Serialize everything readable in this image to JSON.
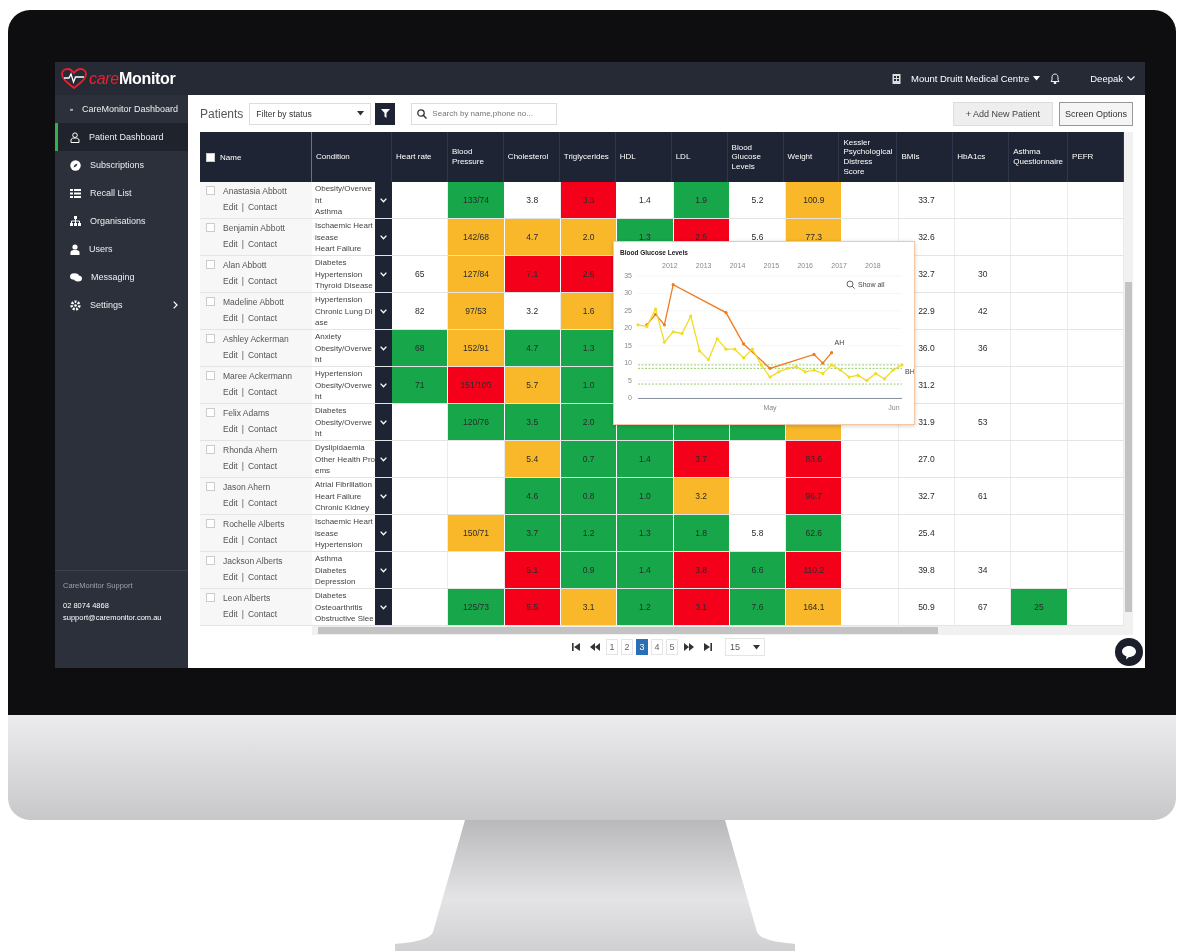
{
  "top_bar": {
    "logo": {
      "accent": "care",
      "text": "Monitor"
    },
    "clinic": "Mount Druitt Medical Centre",
    "user": "Deepak"
  },
  "sidebar": {
    "items": [
      {
        "label": "CareMonitor Dashboard",
        "selected": false,
        "has_submenu": false
      },
      {
        "label": "Patient Dashboard",
        "selected": true,
        "has_submenu": false
      },
      {
        "label": "Subscriptions",
        "selected": false,
        "has_submenu": false
      },
      {
        "label": "Recall List",
        "selected": false,
        "has_submenu": false
      },
      {
        "label": "Organisations",
        "selected": false,
        "has_submenu": false
      },
      {
        "label": "Users",
        "selected": false,
        "has_submenu": false
      },
      {
        "label": "Messaging",
        "selected": false,
        "has_submenu": false
      },
      {
        "label": "Settings",
        "selected": false,
        "has_submenu": true
      }
    ],
    "support": {
      "title": "CareMonitor Support",
      "phone": "02 8074 4868",
      "email": "support@caremonitor.com.au"
    }
  },
  "toolbar": {
    "title": "Patients",
    "filter": "Filter by status",
    "search_placeholder": "Search by name,phone no...",
    "add_button": "+ Add New Patient",
    "options_button": "Screen Options"
  },
  "table": {
    "select_all": {
      "checked": false
    },
    "name_header": "Name",
    "condition_header": "Condition",
    "columns": [
      "Heart rate",
      "Blood Pressure",
      "Cholesterol",
      "Triglycerides",
      "HDL",
      "LDL",
      "Blood Glucose Levels",
      "Weight",
      "Kessler Psychological Distress Score",
      "BMIs",
      "HbA1cs",
      "Asthma Questionnaire",
      "PEFR"
    ],
    "rows": [
      {
        "checked": false,
        "name": "Anastasia Abbott",
        "edit": "Edit",
        "separator": "|",
        "contact": "Contact",
        "conditions": [
          "Obesity/Overwe",
          "ht",
          "Asthma"
        ],
        "cells": [
          null,
          {
            "value": "133/74",
            "color": "#17a74a"
          },
          {
            "value": "3.8"
          },
          {
            "value": "3.3",
            "color": "#f4001b"
          },
          {
            "value": "1.4"
          },
          {
            "value": "1.9",
            "color": "#17a74a"
          },
          {
            "value": "5.2"
          },
          {
            "value": "100.9",
            "color": "#f9b82a"
          },
          null,
          {
            "value": "33.7"
          },
          null,
          null,
          null
        ]
      },
      {
        "checked": false,
        "name": "Benjamin Abbott",
        "edit": "Edit",
        "separator": "|",
        "contact": "Contact",
        "conditions": [
          "Ischaemic Heart",
          "isease",
          "Heart Failure"
        ],
        "cells": [
          null,
          {
            "value": "142/68",
            "color": "#f9b82a"
          },
          {
            "value": "4.7",
            "color": "#f9b82a"
          },
          {
            "value": "2.0",
            "color": "#f9b82a"
          },
          {
            "value": "1.3",
            "color": "#17a74a"
          },
          {
            "value": "2.5",
            "color": "#f4001b"
          },
          {
            "value": "5.6"
          },
          {
            "value": "77.3",
            "color": "#f9b82a"
          },
          null,
          {
            "value": "32.6"
          },
          null,
          null,
          null
        ]
      },
      {
        "checked": false,
        "name": "Alan Abbott",
        "edit": "Edit",
        "separator": "|",
        "contact": "Contact",
        "conditions": [
          "Diabetes",
          "Hypertension",
          "Thyroid Disease"
        ],
        "cells": [
          {
            "value": "65"
          },
          {
            "value": "127/84",
            "color": "#f9b82a"
          },
          {
            "value": "7.1",
            "color": "#f4001b"
          },
          {
            "value": "2.6",
            "color": "#f4001b"
          },
          null,
          null,
          null,
          null,
          null,
          {
            "value": "32.7"
          },
          {
            "value": "30"
          },
          null,
          null
        ]
      },
      {
        "checked": false,
        "name": "Madeline Abbott",
        "edit": "Edit",
        "separator": "|",
        "contact": "Contact",
        "conditions": [
          "Hypertension",
          "Chronic Lung Di",
          "ase"
        ],
        "cells": [
          {
            "value": "82"
          },
          {
            "value": "97/53",
            "color": "#f9b82a"
          },
          {
            "value": "3.2"
          },
          {
            "value": "1.6",
            "color": "#f9b82a"
          },
          null,
          null,
          null,
          null,
          null,
          {
            "value": "22.9"
          },
          {
            "value": "42"
          },
          null,
          null
        ]
      },
      {
        "checked": false,
        "name": "Ashley Ackerman",
        "edit": "Edit",
        "separator": "|",
        "contact": "Contact",
        "conditions": [
          "Anxiety",
          "Obesity/Overwe",
          "ht"
        ],
        "cells": [
          {
            "value": "68",
            "color": "#17a74a"
          },
          {
            "value": "152/91",
            "color": "#f9b82a"
          },
          {
            "value": "4.7",
            "color": "#17a74a"
          },
          {
            "value": "1.3",
            "color": "#17a74a"
          },
          null,
          null,
          null,
          null,
          null,
          {
            "value": "36.0"
          },
          {
            "value": "36"
          },
          null,
          null
        ]
      },
      {
        "checked": false,
        "name": "Maree Ackermann",
        "edit": "Edit",
        "separator": "|",
        "contact": "Contact",
        "conditions": [
          "Hypertension",
          "Obesity/Overwe",
          "ht"
        ],
        "cells": [
          {
            "value": "71",
            "color": "#17a74a"
          },
          {
            "value": "151/100",
            "color": "#f4001b"
          },
          {
            "value": "5.7",
            "color": "#f9b82a"
          },
          {
            "value": "1.0",
            "color": "#17a74a"
          },
          null,
          null,
          null,
          null,
          null,
          {
            "value": "31.2"
          },
          null,
          null,
          null
        ]
      },
      {
        "checked": false,
        "name": "Felix Adams",
        "edit": "Edit",
        "separator": "|",
        "contact": "Contact",
        "conditions": [
          "Diabetes",
          "Obesity/Overwe",
          "ht"
        ],
        "cells": [
          null,
          {
            "value": "120/76",
            "color": "#17a74a"
          },
          {
            "value": "3.5",
            "color": "#17a74a"
          },
          {
            "value": "2.0",
            "color": "#17a74a"
          },
          {
            "color": "#17a74a"
          },
          {
            "color": "#17a74a"
          },
          {
            "color": "#17a74a"
          },
          {
            "color": "#f9b82a"
          },
          null,
          {
            "value": "31.9"
          },
          {
            "value": "53"
          },
          null,
          null
        ]
      },
      {
        "checked": false,
        "name": "Rhonda Ahern",
        "edit": "Edit",
        "separator": "|",
        "contact": "Contact",
        "conditions": [
          "Dyslipidaemia",
          "Other Health Pro",
          "ems"
        ],
        "cells": [
          null,
          null,
          {
            "value": "5.4",
            "color": "#f9b82a"
          },
          {
            "value": "0.7",
            "color": "#17a74a"
          },
          {
            "value": "1.4",
            "color": "#17a74a"
          },
          {
            "value": "3.7",
            "color": "#f4001b"
          },
          null,
          {
            "value": "83.6",
            "color": "#f4001b"
          },
          null,
          {
            "value": "27.0"
          },
          null,
          null,
          null
        ]
      },
      {
        "checked": false,
        "name": "Jason Ahern",
        "edit": "Edit",
        "separator": "|",
        "contact": "Contact",
        "conditions": [
          "Atrial Fibrillation",
          "Heart Failure",
          "Chronic Kidney"
        ],
        "cells": [
          null,
          null,
          {
            "value": "4.6",
            "color": "#17a74a"
          },
          {
            "value": "0.8",
            "color": "#17a74a"
          },
          {
            "value": "1.0",
            "color": "#17a74a"
          },
          {
            "value": "3.2",
            "color": "#f9b82a"
          },
          null,
          {
            "value": "96.7",
            "color": "#f4001b"
          },
          null,
          {
            "value": "32.7"
          },
          {
            "value": "61"
          },
          null,
          null
        ]
      },
      {
        "checked": false,
        "name": "Rochelle Alberts",
        "edit": "Edit",
        "separator": "|",
        "contact": "Contact",
        "conditions": [
          "Ischaemic Heart",
          "isease",
          "Hypertension"
        ],
        "cells": [
          null,
          {
            "value": "150/71",
            "color": "#f9b82a"
          },
          {
            "value": "3.7",
            "color": "#17a74a"
          },
          {
            "value": "1.2",
            "color": "#17a74a"
          },
          {
            "value": "1.3",
            "color": "#17a74a"
          },
          {
            "value": "1.8",
            "color": "#17a74a"
          },
          {
            "value": "5.8"
          },
          {
            "value": "62.6",
            "color": "#17a74a"
          },
          null,
          {
            "value": "25.4"
          },
          null,
          null,
          null
        ]
      },
      {
        "checked": false,
        "name": "Jackson Alberts",
        "edit": "Edit",
        "separator": "|",
        "contact": "Contact",
        "conditions": [
          "Asthma",
          "Diabetes",
          "Depression"
        ],
        "cells": [
          null,
          null,
          {
            "value": "5.1",
            "color": "#f4001b"
          },
          {
            "value": "0.9",
            "color": "#17a74a"
          },
          {
            "value": "1.4",
            "color": "#17a74a"
          },
          {
            "value": "3.8",
            "color": "#f4001b"
          },
          {
            "value": "6.6",
            "color": "#17a74a"
          },
          {
            "value": "110.2",
            "color": "#f4001b"
          },
          null,
          {
            "value": "39.8"
          },
          {
            "value": "34"
          },
          null,
          null
        ]
      },
      {
        "checked": false,
        "name": "Leon Alberts",
        "edit": "Edit",
        "separator": "|",
        "contact": "Contact",
        "conditions": [
          "Diabetes",
          "Osteoarthritis",
          "Obstructive Slee"
        ],
        "cells": [
          null,
          {
            "value": "125/73",
            "color": "#17a74a"
          },
          {
            "value": "5.5",
            "color": "#f4001b"
          },
          {
            "value": "3.1",
            "color": "#f9b82a"
          },
          {
            "value": "1.2",
            "color": "#17a74a"
          },
          {
            "value": "3.1",
            "color": "#f4001b"
          },
          {
            "value": "7.6",
            "color": "#17a74a"
          },
          {
            "value": "164.1",
            "color": "#f9b82a"
          },
          null,
          {
            "value": "50.9"
          },
          {
            "value": "67"
          },
          {
            "value": "25",
            "color": "#17a74a"
          },
          null
        ]
      }
    ]
  },
  "glucose_popover": {
    "show_all": "Show all",
    "chart_data": {
      "type": "line",
      "title": "Blood Glucose Levels",
      "x": [
        2011.06,
        2011.32,
        2011.58,
        2011.84,
        2012.1,
        2012.36,
        2012.62,
        2012.88,
        2013.14,
        2013.4,
        2013.66,
        2013.92,
        2014.18,
        2014.44,
        2014.7,
        2014.96,
        2015.22,
        2015.48,
        2015.74,
        2016,
        2016.26,
        2016.52,
        2016.78,
        2017.04,
        2017.3,
        2017.56,
        2017.82,
        2018.08,
        2018.34,
        2018.6,
        2018.86
      ],
      "series": [
        {
          "name": "AH",
          "color": "#f07a1e",
          "values": [
            null,
            21,
            24,
            21,
            32.5,
            null,
            null,
            null,
            null,
            null,
            24.5,
            null,
            15.5,
            null,
            null,
            8.5,
            null,
            null,
            null,
            null,
            12.5,
            10,
            13,
            null,
            null,
            null,
            null,
            null,
            null,
            null,
            null
          ]
        },
        {
          "name": "BH",
          "color": "#f2dc22",
          "values": [
            21,
            20.5,
            25.5,
            16,
            19,
            18.5,
            23.5,
            13.5,
            11,
            17,
            14,
            14,
            11.5,
            14,
            9.5,
            6,
            7.5,
            8.5,
            9,
            7.5,
            8,
            7,
            9.5,
            8,
            6,
            6.5,
            5,
            7,
            5.5,
            8,
            9.5
          ]
        }
      ],
      "xlim": [
        2011.06,
        2018.86
      ],
      "ylim": [
        0,
        35
      ],
      "yticks": [
        0,
        5,
        10,
        15,
        20,
        25,
        30,
        35
      ],
      "xticks": [
        2012,
        2013,
        2014,
        2015,
        2016,
        2017,
        2018
      ],
      "grid": true,
      "ref_lines": [
        {
          "axis": "y",
          "value": 9.5
        },
        {
          "axis": "y",
          "value": 8.5
        },
        {
          "axis": "y",
          "value": 4
        }
      ],
      "annotations": [
        "May",
        "Jun"
      ]
    }
  },
  "pagination": {
    "pages": [
      {
        "label": "1",
        "selected": false
      },
      {
        "label": "2",
        "selected": false
      },
      {
        "label": "3",
        "selected": true
      },
      {
        "label": "4",
        "selected": false
      },
      {
        "label": "5",
        "selected": false
      }
    ],
    "page_size": "15"
  }
}
